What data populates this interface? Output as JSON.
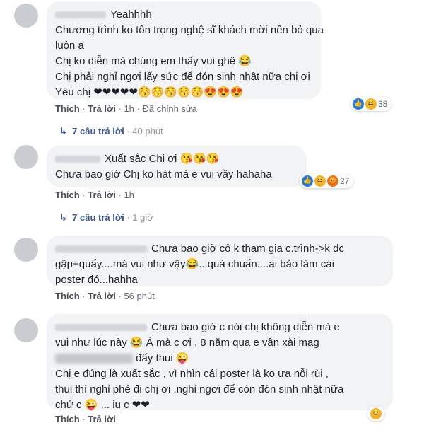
{
  "comments": [
    {
      "lines": [
        "Yeahhhh",
        "Chương trình ko tôn trọng nghệ sĩ khách mời nên bỏ qua",
        "luôn ạ",
        "Chị ko diễn mà chúng em thấy vui ghê 😂",
        "Chị phải nghỉ ngơi lấy sức để đón sinh nhật nữa chị ơi",
        "Yêu chị ❤❤❤❤❤😚😚😚😚😚😍😍😍"
      ],
      "like": "Thích",
      "reply": "Trả lời",
      "time": "1h",
      "edited": "Đã chỉnh sửa",
      "reaction_count": "38",
      "reaction_icons": [
        "👍",
        "😆"
      ],
      "replies_label": "7 câu trả lời",
      "replies_time": "40 phút"
    },
    {
      "lines": [
        "Xuất sắc Chị ơi 😘😘😘",
        "Chưa bao giờ Chị ko hát mà e vui vầy hahaha"
      ],
      "like": "Thích",
      "reply": "Trả lời",
      "time": "1h",
      "reaction_count": "27",
      "reaction_icons": [
        "👍",
        "😆",
        "😡"
      ],
      "replies_label": "7 câu trả lời",
      "replies_time": "1 giờ"
    },
    {
      "lines": [
        "Chưa bao giờ cô k tham gia c.trình->k đc",
        "gập+quẩy....mà vui như vậy😂...quá chuẩn....ai bảo làm cái",
        "poster đó...hahha"
      ],
      "like": "Thích",
      "reply": "Trả lời",
      "time": "56 phút"
    },
    {
      "lines": [
        "Chưa bao giờ c nói chị không diễn mà e",
        "vui như lúc này 😂 À mà c ơi , 8 năm qua e vẫn xài mạg",
        "đấy thui 😜",
        "Chị e đúng là xuất sắc , vì nhìn cái poster là ko ưa nỗi rùi ,",
        "thui thì nghỉ phẻ đi chị ơi .nghỉ ngơi để còn đón sinh nhật nữa",
        "chứ c 😜 ... iu c ❤❤"
      ],
      "like": "Thích",
      "reply": "Trả lời",
      "reaction_icons": [
        "😆"
      ]
    }
  ],
  "separator": "·",
  "reply_arrow": "↳"
}
